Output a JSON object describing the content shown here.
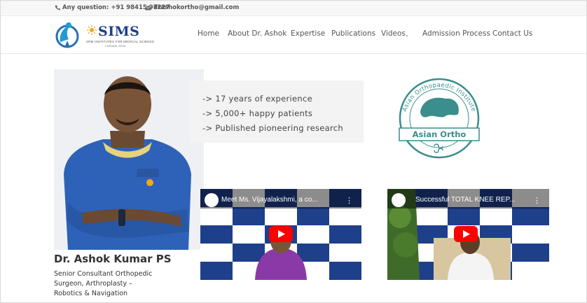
{
  "topbar": {
    "phone": "Any question: +91 98415 97227",
    "email": "drashokortho@gmail.com"
  },
  "logo": {
    "brand": "SIMS",
    "tagline": "SRM INSTITUTES FOR MEDICAL SCIENCE",
    "subline": "CHENNAI, INDIA"
  },
  "nav": {
    "home": "Home",
    "about": "About Dr. Ashok",
    "expertise": "Expertise",
    "publications": "Publications",
    "videos": "Videos",
    "admission": "Admission Process",
    "contact": "Contact Us"
  },
  "doctor": {
    "name": "Dr. Ashok Kumar PS",
    "desc_line1": "Senior Consultant Orthopedic",
    "desc_line2": "Surgeon, Arthroplasty –",
    "desc_line3": "Robotics & Navigation"
  },
  "highlights": [
    "-> 17 years of experience",
    "-> 5,000+ happy patients",
    "-> Published pioneering research"
  ],
  "seal": {
    "arc_text": "Asian Orthopaedic Institute",
    "label": "Asian Ortho"
  },
  "videos": [
    {
      "title": "Meet Ms. Vijayalakshmi, a co..."
    },
    {
      "title": "Successful TOTAL KNEE REP..."
    }
  ],
  "colors": {
    "brand_blue": "#1e3f8a",
    "seal_teal": "#3a8e8c",
    "youtube_red": "#ff0000",
    "scrubs_blue": "#2e62b8"
  },
  "icons": [
    "phone-icon",
    "mail-icon",
    "chevron-down-icon",
    "play-icon",
    "more-vert-icon"
  ]
}
